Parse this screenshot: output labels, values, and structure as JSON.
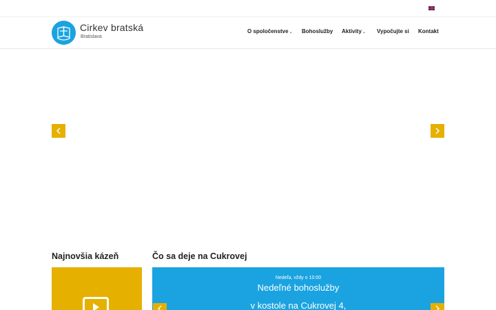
{
  "topbar": {
    "language_flag": "en-flag-icon"
  },
  "brand": {
    "name": "Cirkev bratská",
    "subtitle": "Bratislava"
  },
  "nav": {
    "items": [
      {
        "label": "O spoločenstve",
        "has_dropdown": true
      },
      {
        "label": "Bohoslužby",
        "has_dropdown": false
      },
      {
        "label": "Aktivity",
        "has_dropdown": true
      },
      {
        "label": "Vypočujte si",
        "has_dropdown": false
      },
      {
        "label": "Kontakt",
        "has_dropdown": false
      }
    ],
    "caret": "⌄"
  },
  "sections": {
    "sermon_title": "Najnovšia kázeň",
    "events_title": "Čo sa deje na Cukrovej"
  },
  "events": {
    "time": "Nedeľa, vždy o 10:00",
    "title": "Nedeľné bohoslužby",
    "place": "v kostole na Cukrovej 4,"
  },
  "colors": {
    "accent": "#e6b000",
    "brand_blue": "#1aa3e0"
  }
}
